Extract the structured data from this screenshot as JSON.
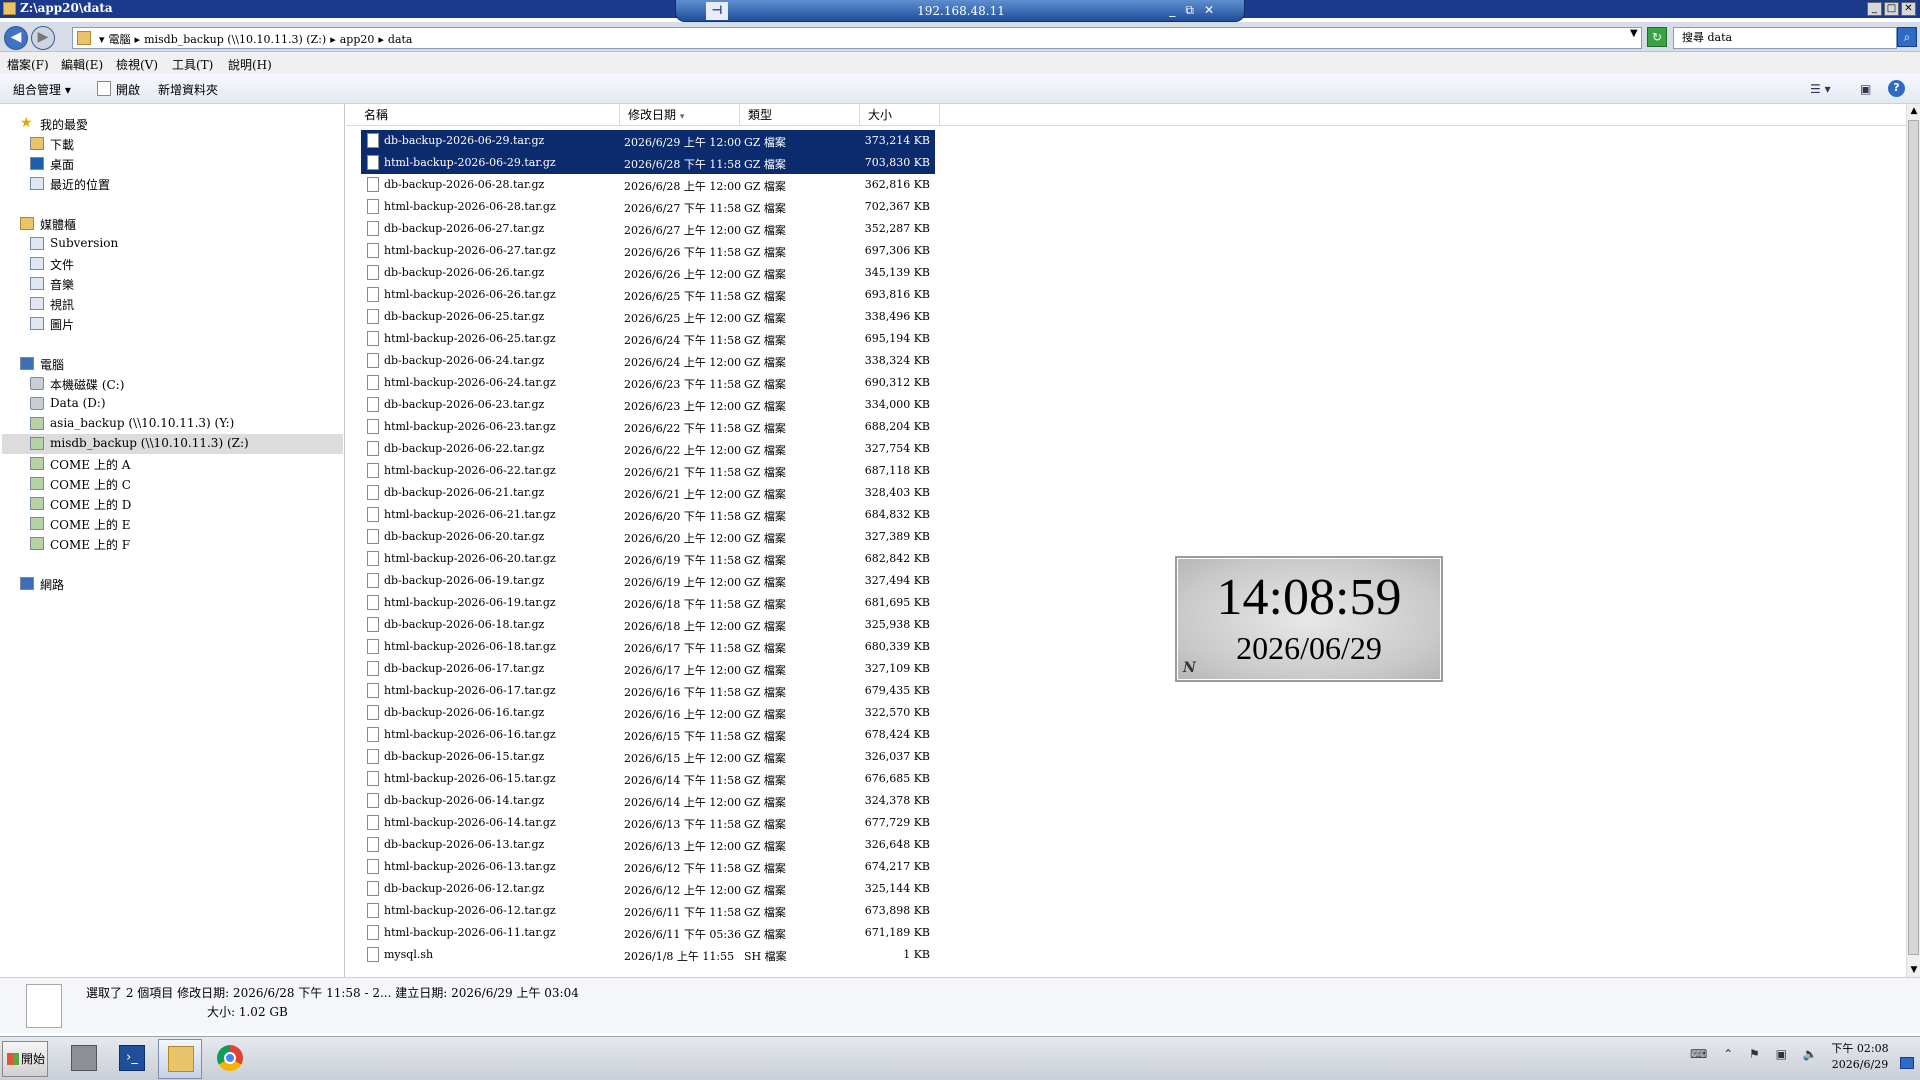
{
  "window": {
    "title": "Z:\\app20\\data"
  },
  "rdp": {
    "host": "192.168.48.11",
    "pin": "⊣",
    "min": "_",
    "restore": "⧉",
    "close": "✕"
  },
  "address": {
    "crumbs": [
      "▾",
      "電腦",
      "▸",
      "misdb_backup (\\\\10.10.11.3) (Z:)",
      "▸",
      "app20",
      "▸",
      "data"
    ],
    "search_placeholder": "搜尋 data"
  },
  "menu": [
    "檔案(F)",
    "編輯(E)",
    "檢視(V)",
    "工具(T)",
    "說明(H)"
  ],
  "commands": {
    "organize": "組合管理 ▾",
    "open": "開啟",
    "new_folder": "新增資料夾"
  },
  "nav": {
    "favorites": {
      "label": "我的最愛",
      "items": [
        "下載",
        "桌面",
        "最近的位置"
      ]
    },
    "libraries": {
      "label": "媒體櫃",
      "items": [
        "Subversion",
        "文件",
        "音樂",
        "視訊",
        "圖片"
      ]
    },
    "computer": {
      "label": "電腦",
      "items": [
        "本機磁碟 (C:)",
        "Data (D:)",
        "asia_backup (\\\\10.10.11.3) (Y:)",
        "misdb_backup (\\\\10.10.11.3) (Z:)",
        "COME 上的 A",
        "COME 上的 C",
        "COME 上的 D",
        "COME 上的 E",
        "COME 上的 F"
      ]
    },
    "network": {
      "label": "網路"
    }
  },
  "columns": {
    "name": "名稱",
    "date": "修改日期",
    "type": "類型",
    "size": "大小"
  },
  "files": [
    {
      "name": "db-backup-2026-06-29.tar.gz",
      "date": "2026/6/29 上午 12:00",
      "type": "GZ 檔案",
      "size": "373,214 KB",
      "selected": true
    },
    {
      "name": "html-backup-2026-06-29.tar.gz",
      "date": "2026/6/28 下午 11:58",
      "type": "GZ 檔案",
      "size": "703,830 KB",
      "selected": true
    },
    {
      "name": "db-backup-2026-06-28.tar.gz",
      "date": "2026/6/28 上午 12:00",
      "type": "GZ 檔案",
      "size": "362,816 KB"
    },
    {
      "name": "html-backup-2026-06-28.tar.gz",
      "date": "2026/6/27 下午 11:58",
      "type": "GZ 檔案",
      "size": "702,367 KB"
    },
    {
      "name": "db-backup-2026-06-27.tar.gz",
      "date": "2026/6/27 上午 12:00",
      "type": "GZ 檔案",
      "size": "352,287 KB"
    },
    {
      "name": "html-backup-2026-06-27.tar.gz",
      "date": "2026/6/26 下午 11:58",
      "type": "GZ 檔案",
      "size": "697,306 KB"
    },
    {
      "name": "db-backup-2026-06-26.tar.gz",
      "date": "2026/6/26 上午 12:00",
      "type": "GZ 檔案",
      "size": "345,139 KB"
    },
    {
      "name": "html-backup-2026-06-26.tar.gz",
      "date": "2026/6/25 下午 11:58",
      "type": "GZ 檔案",
      "size": "693,816 KB"
    },
    {
      "name": "db-backup-2026-06-25.tar.gz",
      "date": "2026/6/25 上午 12:00",
      "type": "GZ 檔案",
      "size": "338,496 KB"
    },
    {
      "name": "html-backup-2026-06-25.tar.gz",
      "date": "2026/6/24 下午 11:58",
      "type": "GZ 檔案",
      "size": "695,194 KB"
    },
    {
      "name": "db-backup-2026-06-24.tar.gz",
      "date": "2026/6/24 上午 12:00",
      "type": "GZ 檔案",
      "size": "338,324 KB"
    },
    {
      "name": "html-backup-2026-06-24.tar.gz",
      "date": "2026/6/23 下午 11:58",
      "type": "GZ 檔案",
      "size": "690,312 KB"
    },
    {
      "name": "db-backup-2026-06-23.tar.gz",
      "date": "2026/6/23 上午 12:00",
      "type": "GZ 檔案",
      "size": "334,000 KB"
    },
    {
      "name": "html-backup-2026-06-23.tar.gz",
      "date": "2026/6/22 下午 11:58",
      "type": "GZ 檔案",
      "size": "688,204 KB"
    },
    {
      "name": "db-backup-2026-06-22.tar.gz",
      "date": "2026/6/22 上午 12:00",
      "type": "GZ 檔案",
      "size": "327,754 KB"
    },
    {
      "name": "html-backup-2026-06-22.tar.gz",
      "date": "2026/6/21 下午 11:58",
      "type": "GZ 檔案",
      "size": "687,118 KB"
    },
    {
      "name": "db-backup-2026-06-21.tar.gz",
      "date": "2026/6/21 上午 12:00",
      "type": "GZ 檔案",
      "size": "328,403 KB"
    },
    {
      "name": "html-backup-2026-06-21.tar.gz",
      "date": "2026/6/20 下午 11:58",
      "type": "GZ 檔案",
      "size": "684,832 KB"
    },
    {
      "name": "db-backup-2026-06-20.tar.gz",
      "date": "2026/6/20 上午 12:00",
      "type": "GZ 檔案",
      "size": "327,389 KB"
    },
    {
      "name": "html-backup-2026-06-20.tar.gz",
      "date": "2026/6/19 下午 11:58",
      "type": "GZ 檔案",
      "size": "682,842 KB"
    },
    {
      "name": "db-backup-2026-06-19.tar.gz",
      "date": "2026/6/19 上午 12:00",
      "type": "GZ 檔案",
      "size": "327,494 KB"
    },
    {
      "name": "html-backup-2026-06-19.tar.gz",
      "date": "2026/6/18 下午 11:58",
      "type": "GZ 檔案",
      "size": "681,695 KB"
    },
    {
      "name": "db-backup-2026-06-18.tar.gz",
      "date": "2026/6/18 上午 12:00",
      "type": "GZ 檔案",
      "size": "325,938 KB"
    },
    {
      "name": "html-backup-2026-06-18.tar.gz",
      "date": "2026/6/17 下午 11:58",
      "type": "GZ 檔案",
      "size": "680,339 KB"
    },
    {
      "name": "db-backup-2026-06-17.tar.gz",
      "date": "2026/6/17 上午 12:00",
      "type": "GZ 檔案",
      "size": "327,109 KB"
    },
    {
      "name": "html-backup-2026-06-17.tar.gz",
      "date": "2026/6/16 下午 11:58",
      "type": "GZ 檔案",
      "size": "679,435 KB"
    },
    {
      "name": "db-backup-2026-06-16.tar.gz",
      "date": "2026/6/16 上午 12:00",
      "type": "GZ 檔案",
      "size": "322,570 KB"
    },
    {
      "name": "html-backup-2026-06-16.tar.gz",
      "date": "2026/6/15 下午 11:58",
      "type": "GZ 檔案",
      "size": "678,424 KB"
    },
    {
      "name": "db-backup-2026-06-15.tar.gz",
      "date": "2026/6/15 上午 12:00",
      "type": "GZ 檔案",
      "size": "326,037 KB"
    },
    {
      "name": "html-backup-2026-06-15.tar.gz",
      "date": "2026/6/14 下午 11:58",
      "type": "GZ 檔案",
      "size": "676,685 KB"
    },
    {
      "name": "db-backup-2026-06-14.tar.gz",
      "date": "2026/6/14 上午 12:00",
      "type": "GZ 檔案",
      "size": "324,378 KB"
    },
    {
      "name": "html-backup-2026-06-14.tar.gz",
      "date": "2026/6/13 下午 11:58",
      "type": "GZ 檔案",
      "size": "677,729 KB"
    },
    {
      "name": "db-backup-2026-06-13.tar.gz",
      "date": "2026/6/13 上午 12:00",
      "type": "GZ 檔案",
      "size": "326,648 KB"
    },
    {
      "name": "html-backup-2026-06-13.tar.gz",
      "date": "2026/6/12 下午 11:58",
      "type": "GZ 檔案",
      "size": "674,217 KB"
    },
    {
      "name": "db-backup-2026-06-12.tar.gz",
      "date": "2026/6/12 上午 12:00",
      "type": "GZ 檔案",
      "size": "325,144 KB"
    },
    {
      "name": "html-backup-2026-06-12.tar.gz",
      "date": "2026/6/11 下午 11:58",
      "type": "GZ 檔案",
      "size": "673,898 KB"
    },
    {
      "name": "html-backup-2026-06-11.tar.gz",
      "date": "2026/6/11 下午 05:36",
      "type": "GZ 檔案",
      "size": "671,189 KB"
    },
    {
      "name": "mysql.sh",
      "date": "2026/1/8 上午 11:55",
      "type": "SH 檔案",
      "size": "1 KB"
    }
  ],
  "clock": {
    "time": "14:08:59",
    "date": "2026/06/29",
    "mark": "N"
  },
  "details": {
    "line1": "選取了 2 個項目   修改日期: 2026/6/28 下午 11:58 - 2...   建立日期: 2026/6/29 上午 03:04",
    "line2": "大小: 1.02 GB"
  },
  "taskbar": {
    "start": "開始",
    "time": "下午 02:08",
    "date": "2026/6/29"
  },
  "icons": {
    "title": "folder-icon",
    "back": "back-arrow-icon",
    "forward": "forward-arrow-icon"
  }
}
